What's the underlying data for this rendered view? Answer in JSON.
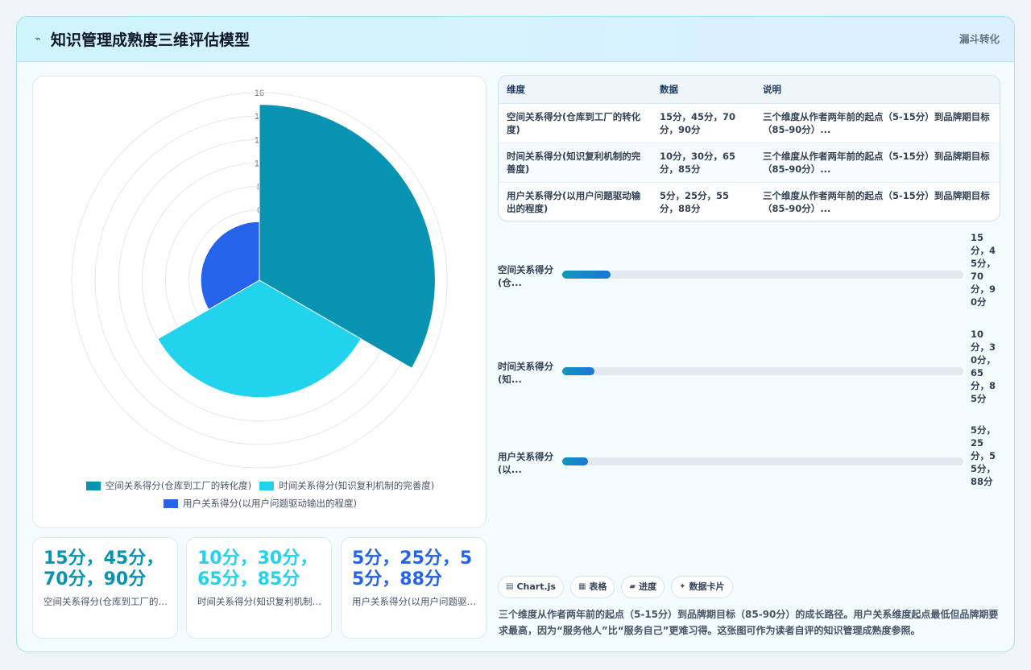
{
  "header": {
    "title": "知识管理成熟度三维评估模型",
    "icon": "lightning-icon",
    "badge": "漏斗转化"
  },
  "colors": {
    "series1": "#0893b3",
    "series2": "#22d3ee",
    "series3": "#2563eb"
  },
  "chart_data": {
    "type": "polarArea",
    "r_ticks": [
      "16",
      "14",
      "12",
      "10",
      "8",
      "6",
      "4",
      "2",
      "0"
    ],
    "rmax": 16,
    "series": [
      {
        "name": "空间关系得分(仓库到工厂的转化度)",
        "value": 15
      },
      {
        "name": "时间关系得分(知识复利机制的完善度)",
        "value": 10
      },
      {
        "name": "用户关系得分(以用户问题驱动输出的程度)",
        "value": 5
      }
    ],
    "legend_position": "bottom"
  },
  "stats": [
    {
      "value": "15分，45分，70分，90分",
      "label": "空间关系得分(仓库到工厂的转化度)"
    },
    {
      "value": "10分，30分，65分，85分",
      "label": "时间关系得分(知识复利机制的完善度)"
    },
    {
      "value": "5分，25分，55分，88分",
      "label": "用户关系得分(以用户问题驱动输出的程度)"
    }
  ],
  "table": {
    "headers": [
      "维度",
      "数据",
      "说明"
    ],
    "rows": [
      [
        "空间关系得分(仓库到工厂的转化度)",
        "15分，45分，70分，90分",
        "三个维度从作者两年前的起点（5-15分）到品牌期目标（85-90分）..."
      ],
      [
        "时间关系得分(知识复利机制的完善度)",
        "10分，30分，65分，85分",
        "三个维度从作者两年前的起点（5-15分）到品牌期目标（85-90分）..."
      ],
      [
        "用户关系得分(以用户问题驱动输出的程度)",
        "5分，25分，55分，88分",
        "三个维度从作者两年前的起点（5-15分）到品牌期目标（85-90分）..."
      ]
    ]
  },
  "progress": [
    {
      "label": "空间关系得分(仓...",
      "value": "15分，45分，70分，90分",
      "fraction": 0.12
    },
    {
      "label": "时间关系得分(知...",
      "value": "10分，30分，65分，85分",
      "fraction": 0.08
    },
    {
      "label": "用户关系得分(以...",
      "value": "5分，25分，55分，88分",
      "fraction": 0.065
    }
  ],
  "chips": [
    {
      "icon": "chart-icon",
      "glyph": "▤",
      "label": "Chart.js"
    },
    {
      "icon": "table-icon",
      "glyph": "▦",
      "label": "表格"
    },
    {
      "icon": "progress-icon",
      "glyph": "▰",
      "label": "进度"
    },
    {
      "icon": "card-icon",
      "glyph": "✦",
      "label": "数据卡片"
    }
  ],
  "summary": "三个维度从作者两年前的起点（5-15分）到品牌期目标（85-90分）的成长路径。用户关系维度起点最低但品牌期要求最高，因为“服务他人”比“服务自己”更难习得。这张图可作为读者自评的知识管理成熟度参照。"
}
